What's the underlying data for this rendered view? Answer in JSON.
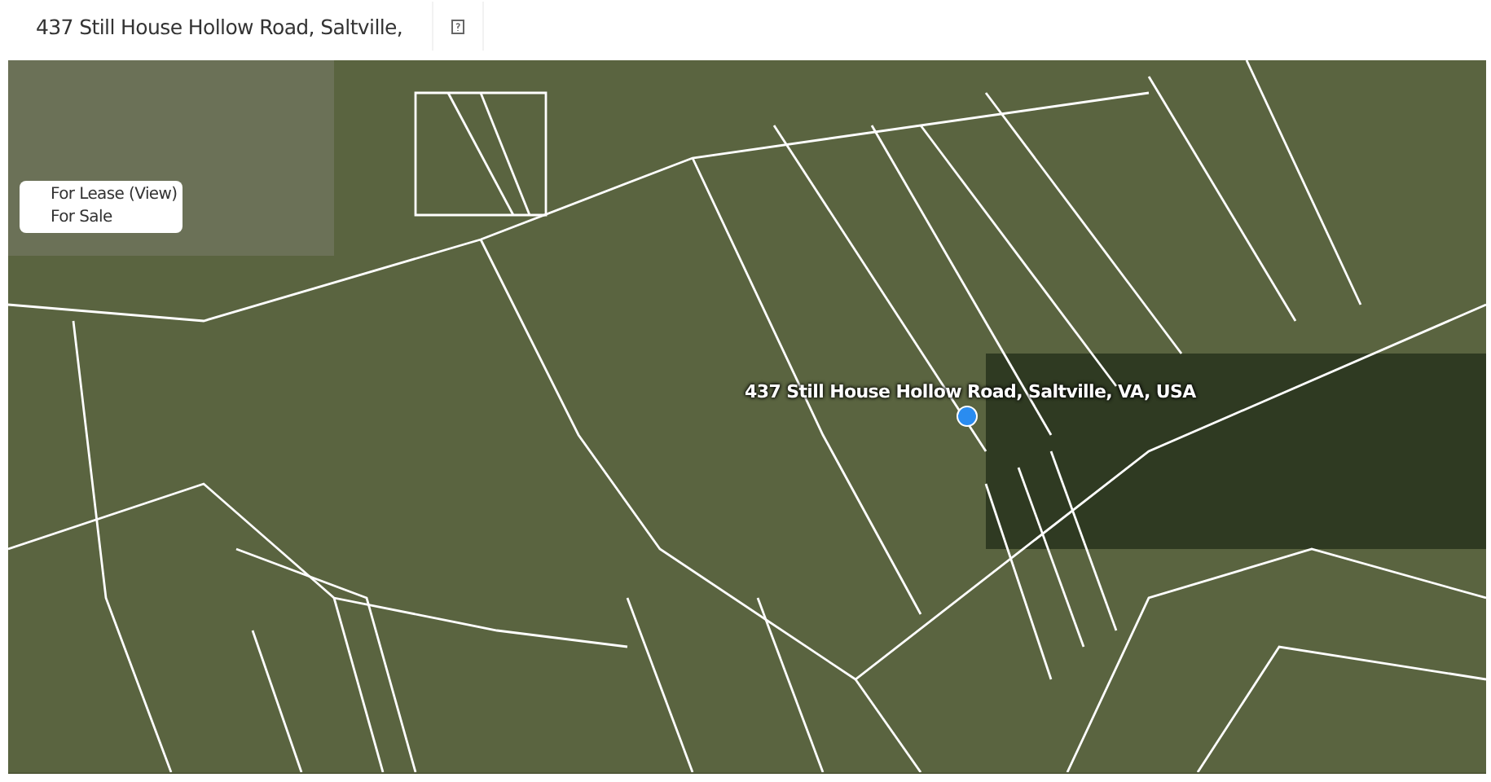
{
  "header": {
    "title": "437 Still House Hollow Road, Saltville,"
  },
  "map": {
    "legend": [
      {
        "label": "For Lease (View)"
      },
      {
        "label": "For Sale"
      }
    ],
    "location_label": "437 Still House Hollow Road, Saltville, VA, USA"
  }
}
